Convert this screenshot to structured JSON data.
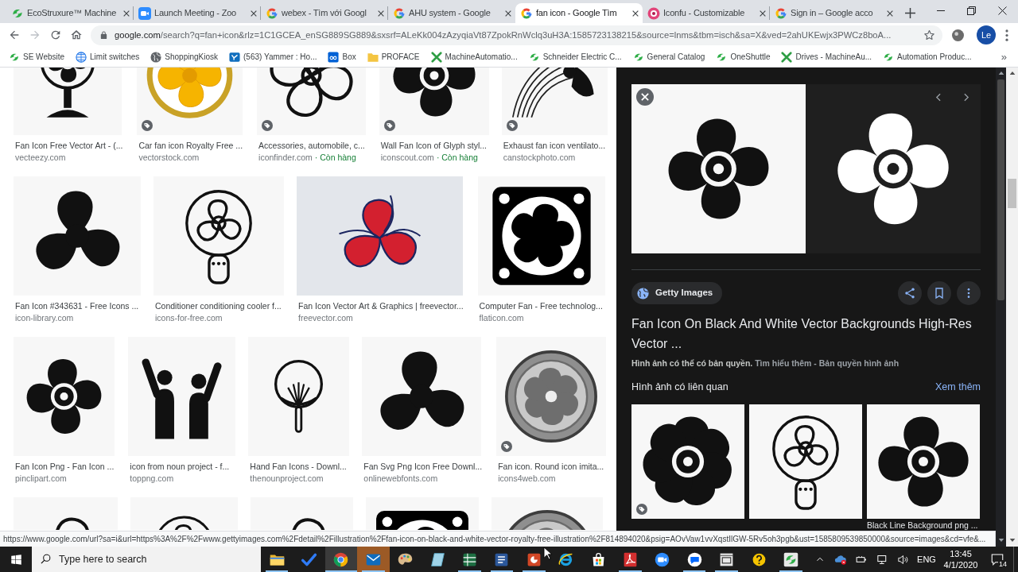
{
  "tabs": [
    {
      "title": "EcoStruxure™ Machine",
      "kind": "swirl",
      "selected": false
    },
    {
      "title": "Launch Meeting - Zoo",
      "kind": "camera",
      "selected": false
    },
    {
      "title": "webex - Tìm với Googl",
      "kind": "g",
      "selected": false
    },
    {
      "title": "AHU system - Google",
      "kind": "g",
      "selected": false
    },
    {
      "title": "fan icon - Google Tìm",
      "kind": "g",
      "selected": true
    },
    {
      "title": "Iconfu - Customizable",
      "kind": "badge",
      "selected": false
    },
    {
      "title": "Sign in – Google acco",
      "kind": "g",
      "selected": false
    }
  ],
  "toolbar": {
    "nav": [
      {
        "kind": "back",
        "disabled": false
      },
      {
        "kind": "forward",
        "disabled": true
      },
      {
        "kind": "reload",
        "disabled": false
      },
      {
        "kind": "home",
        "disabled": false
      }
    ],
    "url_host": "google.com",
    "url_rest": "/search?q=fan+icon&rlz=1C1GCEA_enSG889SG889&sxsrf=ALeKk004zAzyqiaVt87ZpokRnWclq3uH3A:1585723138215&source=lnms&tbm=isch&sa=X&ved=2ahUKEwjx3PWCz8boA...",
    "profile": "Le"
  },
  "bookmarks": {
    "items": [
      {
        "label": "SE Website",
        "kind": "swirl"
      },
      {
        "label": "Limit switches",
        "kind": "grid"
      },
      {
        "label": "ShoppingKiosk",
        "kind": "globe"
      },
      {
        "label": "(563) Yammer : Ho...",
        "kind": "tile"
      },
      {
        "label": "Box",
        "kind": "square"
      },
      {
        "label": "PROFACE",
        "kind": "folder"
      },
      {
        "label": "MachineAutomatio...",
        "kind": "cross"
      },
      {
        "label": "Schneider Electric C...",
        "kind": "swirl"
      },
      {
        "label": "General Catalog",
        "kind": "swirl"
      },
      {
        "label": "OneShuttle",
        "kind": "swirl"
      },
      {
        "label": "Drives - MachineAu...",
        "kind": "cross"
      },
      {
        "label": "Automation Produc...",
        "kind": "swirl"
      }
    ],
    "overflow": "»"
  },
  "results": {
    "rows": [
      {
        "items": [
          {
            "kind": "desk",
            "title": "Fan Icon Free Vector Art - (...",
            "source": "vecteezy.com",
            "tagged": false
          },
          {
            "kind": "ring",
            "title": "Car fan icon Royalty Free ...",
            "source": "vectorstock.com",
            "tagged": true
          },
          {
            "kind": "outline",
            "title": "Accessories, automobile, c...",
            "source": "iconfinder.com",
            "availability": "· Còn hàng",
            "tagged": true
          },
          {
            "kind": "solid",
            "title": "Wall Fan Icon of Glyph styl...",
            "source": "iconscout.com",
            "availability": "· Còn hàng",
            "tagged": true
          },
          {
            "kind": "lined",
            "title": "Exhaust fan icon ventilato...",
            "source": "canstockphoto.com",
            "tagged": true
          }
        ]
      },
      {
        "items": [
          {
            "kind": "propeller",
            "title": "Fan Icon #343631 - Free Icons ...",
            "source": "icon-library.com",
            "tagged": false
          },
          {
            "kind": "stand",
            "title": "Conditioner conditioning cooler f...",
            "source": "icons-for-free.com",
            "tagged": false
          },
          {
            "kind": "gradient",
            "title": "Fan Icon Vector Art & Graphics | freevector...",
            "source": "freevector.com",
            "tagged": false
          },
          {
            "kind": "framed",
            "title": "Computer Fan - Free technolog...",
            "source": "flaticon.com",
            "tagged": false
          }
        ]
      },
      {
        "items": [
          {
            "kind": "solid",
            "title": "Fan Icon Png - Fan Icon ...",
            "source": "pinclipart.com",
            "tagged": false
          },
          {
            "kind": "figures",
            "title": "icon from noun project - f...",
            "source": "toppng.com",
            "tagged": false
          },
          {
            "kind": "handheld",
            "title": "Hand Fan Icons - Downl...",
            "source": "thenounproject.com",
            "tagged": false
          },
          {
            "kind": "propeller",
            "title": "Fan Svg Png Icon Free Downl...",
            "source": "onlinewebfonts.com",
            "tagged": false
          },
          {
            "kind": "metal",
            "title": "Fan icon. Round icon imita...",
            "source": "icons4web.com",
            "tagged": true
          }
        ]
      },
      {
        "items": [
          {
            "kind": "outline",
            "tagged": false
          },
          {
            "kind": "stand",
            "tagged": false
          },
          {
            "kind": "outline",
            "tagged": false
          },
          {
            "kind": "framed",
            "tagged": false
          },
          {
            "kind": "metal",
            "tagged": false
          }
        ]
      }
    ]
  },
  "preview": {
    "images": [
      {
        "kind": "solid"
      },
      {
        "kind": "inverse"
      }
    ],
    "source": "Getty Images",
    "title": "Fan Icon On Black And White Vector Backgrounds High-Res Vector ...",
    "notice": "Hình ảnh có thể có bản quyền.",
    "learn_more": "Tìm hiểu thêm",
    "separator": "-",
    "rights": "Bản quyền hình ảnh",
    "related_heading": "Hình ảnh có liên quan",
    "see_more": "Xem thêm",
    "related": [
      {
        "kind": "radial",
        "tagged": true
      },
      {
        "kind": "stand",
        "tagged": false
      },
      {
        "kind": "solid",
        "tagged": false,
        "caption": "Black Line Background png ..."
      }
    ]
  },
  "status_url": "https://www.google.com/url?sa=i&url=https%3A%2F%2Fwww.gettyimages.com%2Fdetail%2Fillustration%2Ffan-icon-on-black-and-white-vector-royalty-free-illustration%2F814894020&psig=AOvVaw1vvXqstIlGW-5Rv5oh3pgb&ust=1585809539850000&source=images&cd=vfe&...",
  "taskbar": {
    "search_placeholder": "Type here to search",
    "apps": [
      {
        "kind": "folder",
        "running": true,
        "selected": false,
        "attention": false
      },
      {
        "kind": "check",
        "running": false,
        "selected": false,
        "attention": false
      },
      {
        "kind": "chrome",
        "running": true,
        "selected": true,
        "attention": false
      },
      {
        "kind": "mail",
        "running": true,
        "selected": false,
        "attention": true
      },
      {
        "kind": "paint",
        "running": false,
        "selected": false,
        "attention": false
      },
      {
        "kind": "glass",
        "running": false,
        "selected": false,
        "attention": false
      },
      {
        "kind": "sheet",
        "running": true,
        "selected": false,
        "attention": false
      },
      {
        "kind": "doc",
        "running": true,
        "selected": false,
        "attention": false
      },
      {
        "kind": "slides",
        "running": true,
        "selected": false,
        "attention": false
      },
      {
        "kind": "ie",
        "running": false,
        "selected": false,
        "attention": false
      },
      {
        "kind": "store",
        "running": false,
        "selected": false,
        "attention": false
      },
      {
        "kind": "pdf",
        "running": true,
        "selected": false,
        "attention": false
      },
      {
        "kind": "video",
        "running": false,
        "selected": false,
        "attention": false
      },
      {
        "kind": "chat",
        "running": true,
        "selected": false,
        "attention": false
      },
      {
        "kind": "card",
        "running": true,
        "selected": false,
        "attention": false
      },
      {
        "kind": "help",
        "running": false,
        "selected": false,
        "attention": false
      },
      {
        "kind": "swirl",
        "running": true,
        "selected": false,
        "attention": false
      }
    ],
    "language": "ENG",
    "time": "13:45",
    "date": "4/1/2020",
    "notifications": "14"
  }
}
